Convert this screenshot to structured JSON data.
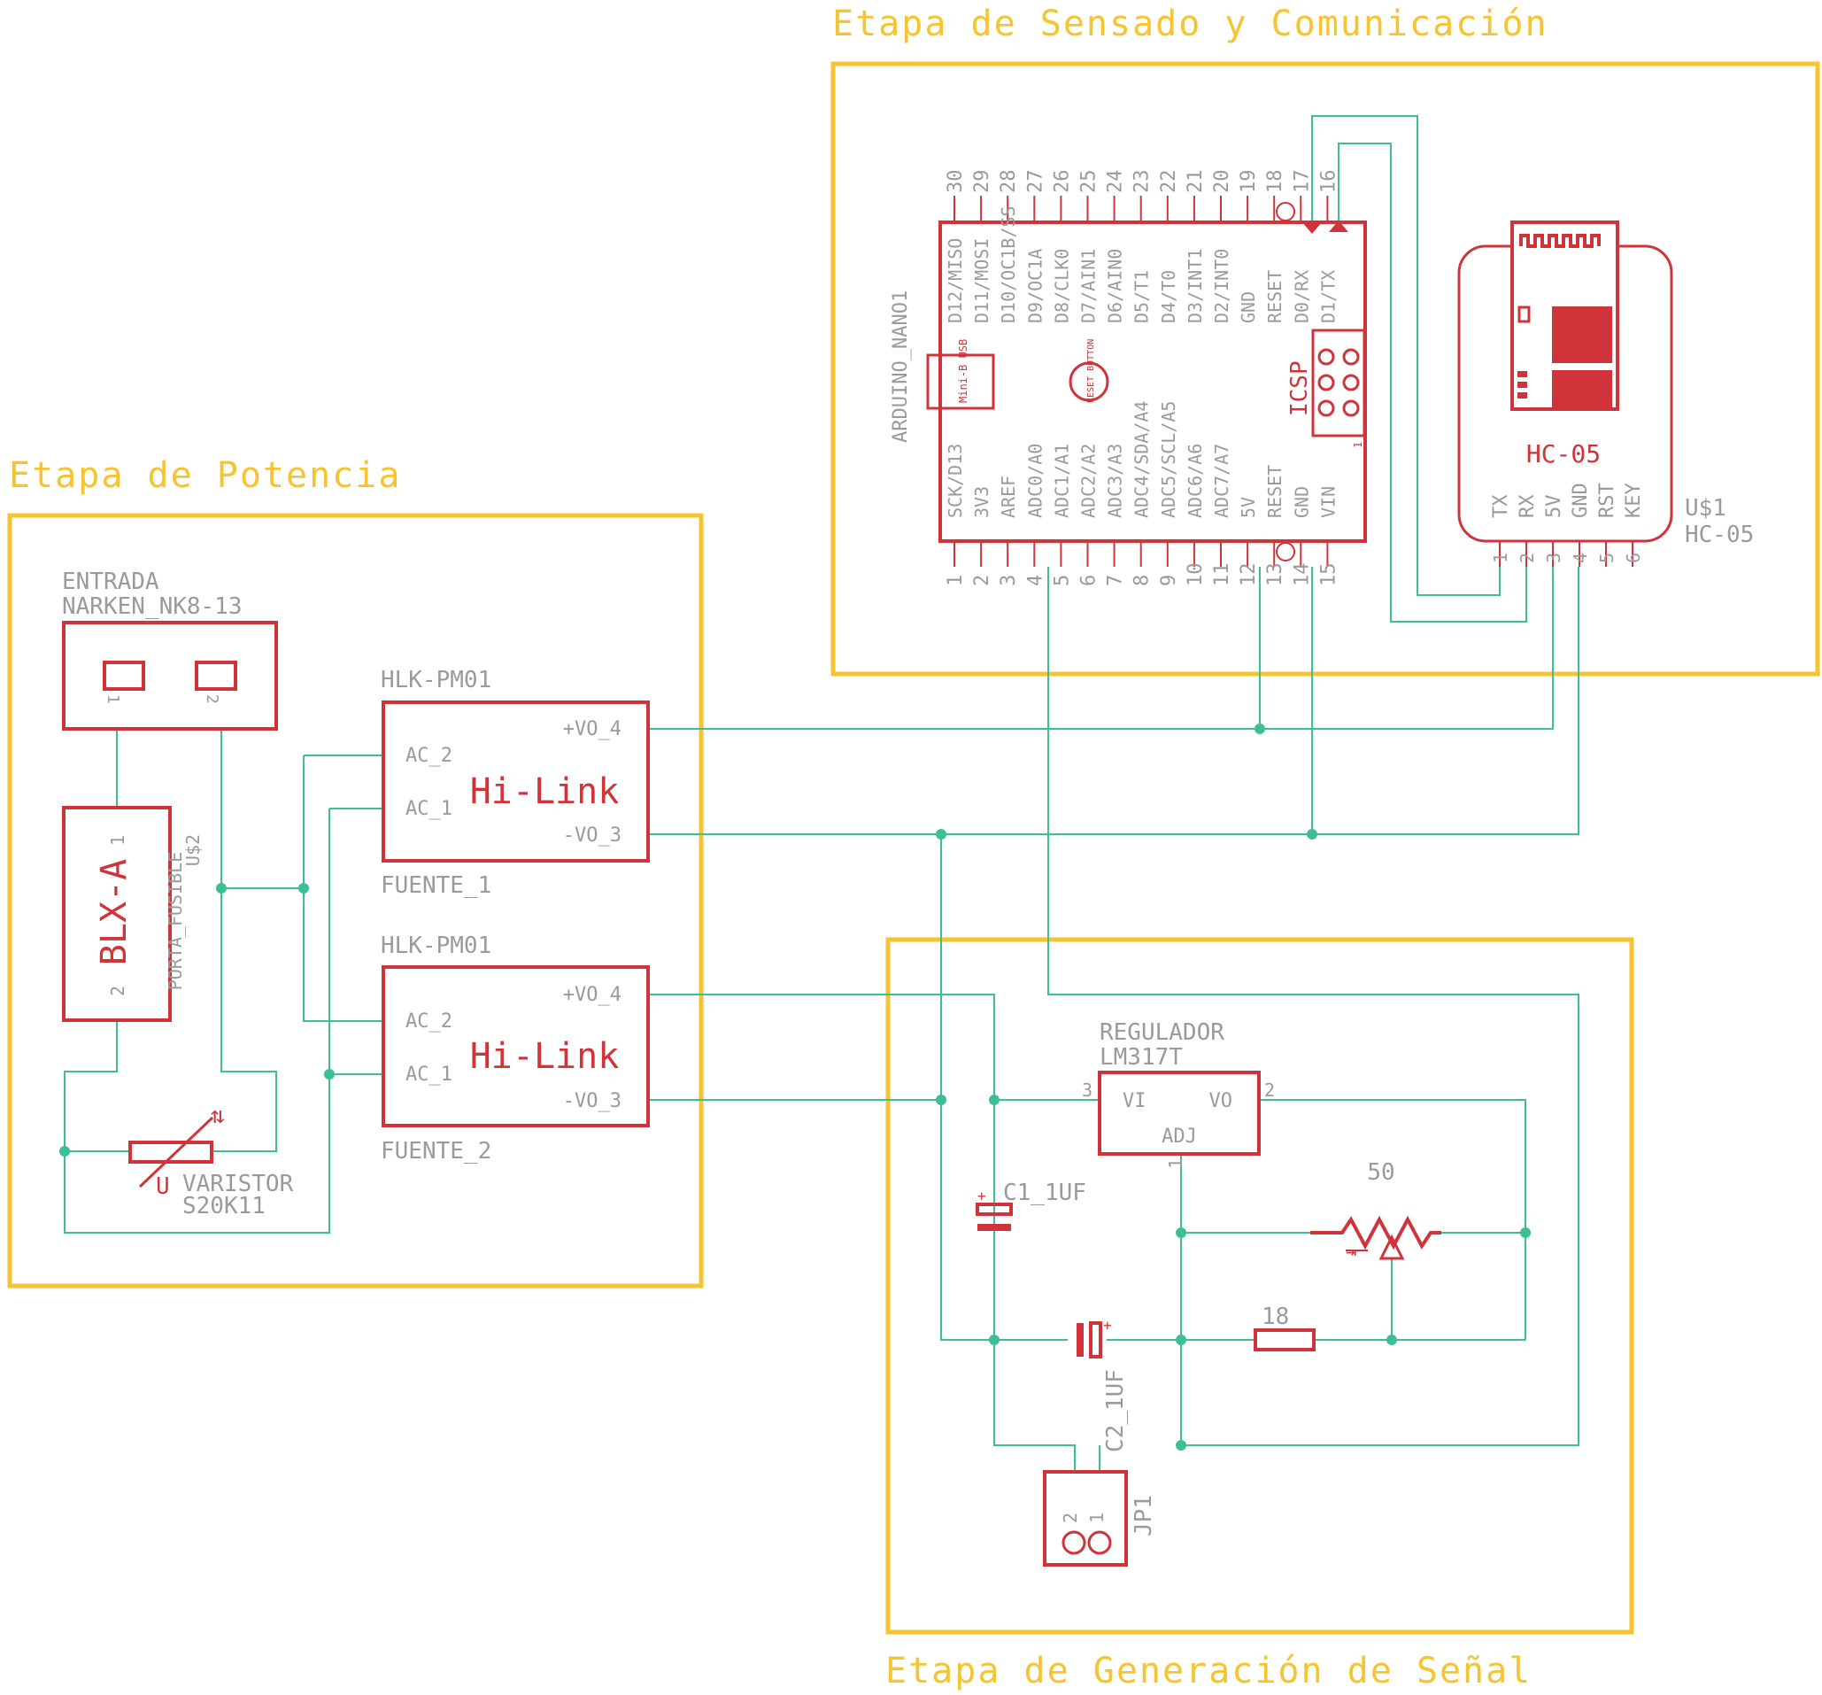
{
  "colors": {
    "frame": "#f7c431",
    "part": "#d0343a",
    "wire": "#3dbf95",
    "label": "#9a9a9a",
    "background": "#ffffff"
  },
  "frames": {
    "sensado": "Etapa de Sensado y Comunicación",
    "potencia": "Etapa de Potencia",
    "senal": "Etapa de Generación de Señal"
  },
  "entrada": {
    "name": "ENTRADA",
    "value": "NARKEN_NK8-13",
    "pin1": "1",
    "pin2": "2"
  },
  "fuse": {
    "name": "U$2",
    "value": "PORTA_FUSIBLE",
    "body": "BLX-A",
    "pin1": "1",
    "pin2": "2"
  },
  "varistor": {
    "name": "VARISTOR",
    "value": "S20K11",
    "symbol": "U"
  },
  "fuente1": {
    "model": "HLK-PM01",
    "brand": "Hi-Link",
    "name": "FUENTE_1",
    "ac2": "AC_2",
    "ac1": "AC_1",
    "vo4": "+VO_4",
    "vo3": "-VO_3"
  },
  "fuente2": {
    "model": "HLK-PM01",
    "brand": "Hi-Link",
    "name": "FUENTE_2",
    "ac2": "AC_2",
    "ac1": "AC_1",
    "vo4": "+VO_4",
    "vo3": "-VO_3"
  },
  "nano": {
    "name": "ARDUINO_NANO1",
    "usb": "Mini-B USB",
    "reset": "RESET BUTTON",
    "icsp": "ICSP",
    "icsp_pin": "1",
    "top_pins": [
      "30",
      "29",
      "28",
      "27",
      "26",
      "25",
      "24",
      "23",
      "22",
      "21",
      "20",
      "19",
      "18",
      "17",
      "16"
    ],
    "top_labels": [
      "D12/MISO",
      "D11/MOSI",
      "D10/OC1B/SS",
      "D9/OC1A",
      "D8/CLK0",
      "D7/AIN1",
      "D6/AIN0",
      "D5/T1",
      "D4/T0",
      "D3/INT1",
      "D2/INT0",
      "GND",
      "RESET",
      "D0/RX",
      "D1/TX"
    ],
    "bottom_pins": [
      "1",
      "2",
      "3",
      "4",
      "5",
      "6",
      "7",
      "8",
      "9",
      "10",
      "11",
      "12",
      "13",
      "14",
      "15"
    ],
    "bottom_labels": [
      "SCK/D13",
      "3V3",
      "AREF",
      "ADC0/A0",
      "ADC1/A1",
      "ADC2/A2",
      "ADC3/A3",
      "ADC4/SDA/A4",
      "ADC5/SCL/A5",
      "ADC6/A6",
      "ADC7/A7",
      "5V",
      "RESET",
      "GND",
      "VIN"
    ]
  },
  "hc05": {
    "name": "U$1",
    "value": "HC-05",
    "module_label": "HC-05",
    "pin_labels": [
      "TX",
      "RX",
      "5V",
      "GND",
      "RST",
      "KEY"
    ],
    "pin_numbers": [
      "1",
      "2",
      "3",
      "4",
      "5",
      "6"
    ]
  },
  "regulador": {
    "name": "REGULADOR",
    "value": "LM317T",
    "vi": "VI",
    "vo": "VO",
    "adj": "ADJ",
    "pin3": "3",
    "pin2": "2",
    "pin1": "1"
  },
  "c1": {
    "name": "C1_1UF",
    "plus": "+"
  },
  "c2": {
    "name": "C2_1UF",
    "plus": "+"
  },
  "pot": {
    "value": "50"
  },
  "resistor": {
    "value": "18"
  },
  "jp1": {
    "name": "JP1",
    "pin1": "1",
    "pin2": "2"
  }
}
